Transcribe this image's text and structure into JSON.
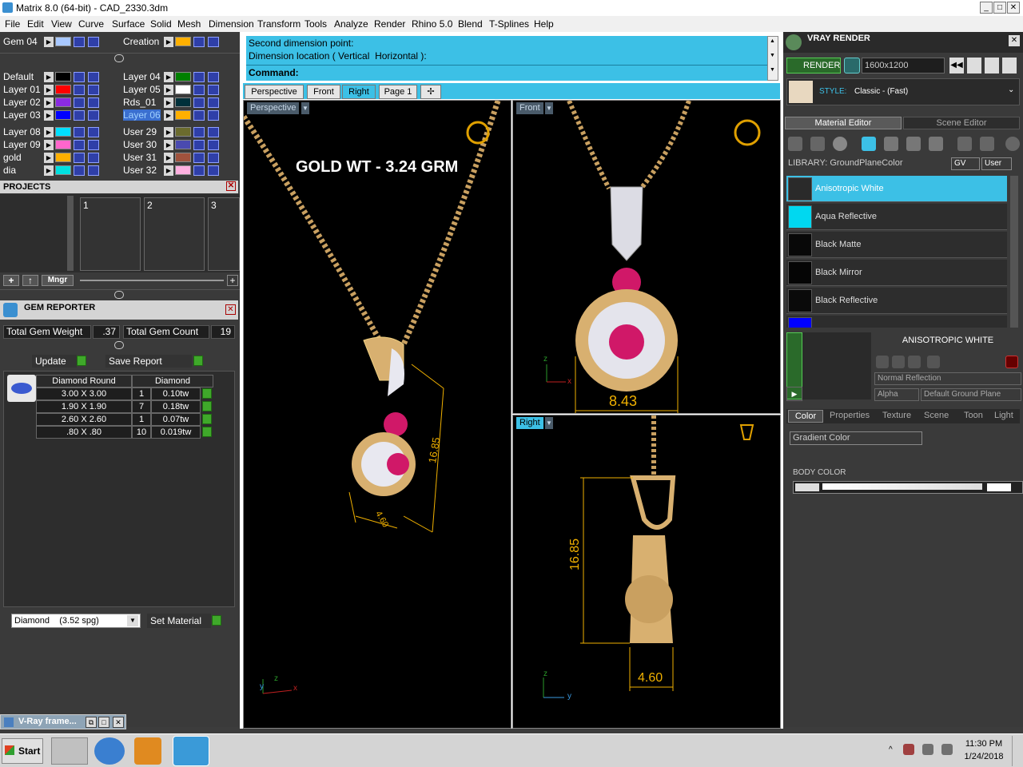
{
  "window": {
    "title": "Matrix 8.0 (64-bit) - CAD_2330.3dm"
  },
  "menu": [
    "File",
    "Edit",
    "View",
    "Curve",
    "Surface",
    "Solid",
    "Mesh",
    "Dimension",
    "Transform",
    "Tools",
    "Analyze",
    "Render",
    "Rhino 5.0",
    "Blend",
    "T-Splines",
    "Help"
  ],
  "layers_top": [
    {
      "name": "Gem 04",
      "color": "#a8c8ff"
    },
    {
      "name": "Creation",
      "color": "#ffb000"
    }
  ],
  "layers_left": [
    {
      "name": "Default",
      "color": "#000000"
    },
    {
      "name": "Layer 01",
      "color": "#ff0000"
    },
    {
      "name": "Layer 02",
      "color": "#8a2be2"
    },
    {
      "name": "Layer 03",
      "color": "#0000ff"
    },
    {
      "name": "Layer 08",
      "color": "#00e0ff"
    },
    {
      "name": "Layer 09",
      "color": "#ff66cc"
    },
    {
      "name": "gold",
      "color": "#ffb000"
    },
    {
      "name": "dia",
      "color": "#00e0e0"
    }
  ],
  "layers_right": [
    {
      "name": "Layer 04",
      "color": "#008000"
    },
    {
      "name": "Layer 05",
      "color": "#ffffff"
    },
    {
      "name": "Rds_01",
      "color": "#00303a"
    },
    {
      "name": "Layer 06",
      "color": "#ffb000"
    },
    {
      "name": "User 29",
      "color": "#6b6b2e"
    },
    {
      "name": "User 30",
      "color": "#4a4ab0"
    },
    {
      "name": "User 31",
      "color": "#a0523d"
    },
    {
      "name": "User 32",
      "color": "#ffb0e0"
    }
  ],
  "projects": {
    "title": "PROJECTS",
    "slots": [
      "1",
      "2",
      "3"
    ],
    "mngr": "Mngr"
  },
  "gem_reporter": {
    "title": "GEM REPORTER",
    "total_weight_label": "Total Gem Weight",
    "total_weight": ".37",
    "total_count_label": "Total Gem Count",
    "total_count": "19",
    "update": "Update",
    "save_report": "Save Report",
    "col1": "Diamond Round",
    "col2": "Diamond",
    "rows": [
      {
        "size": "3.00 X 3.00",
        "qty": "1",
        "tw": "0.10tw"
      },
      {
        "size": "1.90 X 1.90",
        "qty": "7",
        "tw": "0.18tw"
      },
      {
        "size": "2.60 X 2.60",
        "qty": "1",
        "tw": "0.07tw"
      },
      {
        "size": ".80 X .80",
        "qty": "10",
        "tw": "0.019tw"
      }
    ],
    "material": "Diamond    (3.52 spg)",
    "set_material": "Set Material"
  },
  "vray_frame": "V-Ray frame...",
  "command": {
    "line1": "Second dimension point:",
    "line2": "Dimension location ( Vertical  Horizontal ):",
    "line3": "Command:"
  },
  "tabs": [
    "Perspective",
    "Front",
    "Right",
    "Page 1"
  ],
  "viewports": {
    "perspective": "Perspective",
    "front": "Front",
    "right": "Right"
  },
  "gold_weight": "GOLD WT - 3.24 GRM",
  "dims": {
    "front_width": "8.43",
    "persp_height": "16.85",
    "persp_width": "4.60",
    "right_height": "16.85",
    "right_width": "4.60"
  },
  "vray": {
    "title": "VRAY RENDER",
    "render": "RENDER",
    "resolution": "1600x1200",
    "style_label": "STYLE:",
    "style_value": "Classic - (Fast)",
    "tab_material": "Material Editor",
    "tab_scene": "Scene Editor",
    "library": "LIBRARY: GroundPlaneColor",
    "gv": "GV",
    "user": "User",
    "materials": [
      {
        "name": "Anisotropic White",
        "color": "#2a2a2a"
      },
      {
        "name": "Aqua Reflective",
        "color": "#00d8f0"
      },
      {
        "name": "Black Matte",
        "color": "#080808"
      },
      {
        "name": "Black Mirror",
        "color": "#050505"
      },
      {
        "name": "Black Reflective",
        "color": "#0a0a0a"
      }
    ],
    "selected_name": "ANISOTROPIC WHITE",
    "reflection": "Normal Reflection",
    "alpha": "Alpha",
    "ground": "Default Ground Plane",
    "subtabs": [
      "Color",
      "Properties",
      "Texture",
      "Scene",
      "Toon",
      "Light"
    ],
    "gradient": "Gradient Color",
    "body_color": "BODY COLOR"
  },
  "taskbar": {
    "start": "Start",
    "time": "11:30 PM",
    "date": "1/24/2018"
  }
}
